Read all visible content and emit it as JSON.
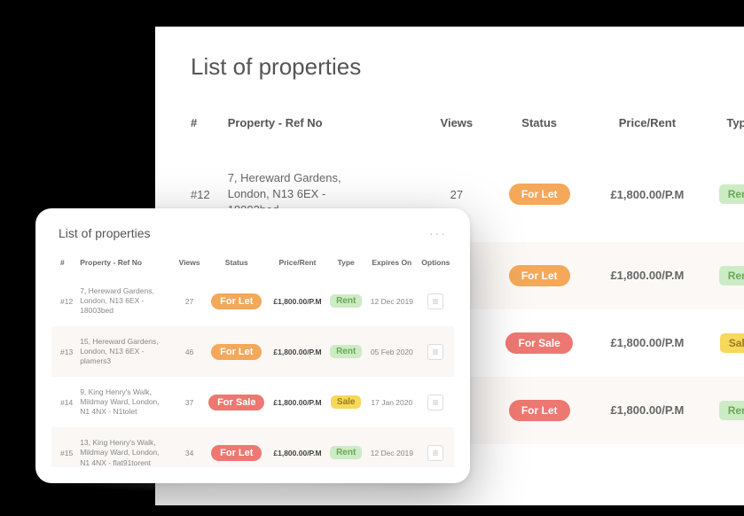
{
  "main": {
    "title": "List of properties",
    "columns": {
      "num": "#",
      "property": "Property - Ref No",
      "views": "Views",
      "status": "Status",
      "price": "Price/Rent",
      "type": "Type"
    },
    "rows": [
      {
        "num": "#12",
        "addr1": "7, Hereward Gardens,",
        "addr2": "London, N13 6EX - 18003bed",
        "views": "27",
        "status": "For Let",
        "status_kind": "orange",
        "price": "£1,800.00/P.M",
        "type": "Rent",
        "type_kind": "green",
        "alt": false
      },
      {
        "num": "",
        "addr1": "",
        "addr2": "",
        "views": "",
        "status": "For Let",
        "status_kind": "orange",
        "price": "£1,800.00/P.M",
        "type": "Rent",
        "type_kind": "green",
        "alt": true
      },
      {
        "num": "",
        "addr1": "",
        "addr2": "",
        "views": "",
        "status": "For Sale",
        "status_kind": "red",
        "price": "£1,800.00/P.M",
        "type": "Sale",
        "type_kind": "yellow",
        "alt": false
      },
      {
        "num": "",
        "addr1": "",
        "addr2": "",
        "views": "",
        "status": "For Let",
        "status_kind": "red",
        "price": "£1,800.00/P.M",
        "type": "Rent",
        "type_kind": "green",
        "alt": true
      }
    ]
  },
  "device": {
    "title": "List of properties",
    "menu_glyph": "···",
    "columns": {
      "num": "#",
      "property": "Property - Ref No",
      "views": "Views",
      "status": "Status",
      "price": "Price/Rent",
      "type": "Type",
      "expires": "Expires On",
      "options": "Options"
    },
    "rows": [
      {
        "num": "#12",
        "addr1": "7, Hereward Gardens,",
        "addr2": "London, N13 6EX - 18003bed",
        "views": "27",
        "status": "For Let",
        "status_kind": "orange",
        "price": "£1,800.00/P.M",
        "type": "Rent",
        "type_kind": "green",
        "expires": "12 Dec 2019",
        "alt": false
      },
      {
        "num": "#13",
        "addr1": "15, Hereward Gardens,",
        "addr2": "London, N13 6EX - plamers3",
        "views": "46",
        "status": "For Let",
        "status_kind": "orange",
        "price": "£1,800.00/P.M",
        "type": "Rent",
        "type_kind": "green",
        "expires": "05 Feb 2020",
        "alt": true
      },
      {
        "num": "#14",
        "addr1": "9, King Henry's Walk,",
        "addr2": "Mildmay Ward, London,",
        "addr3": "N1 4NX - N1tolet",
        "views": "37",
        "status": "For Sale",
        "status_kind": "red",
        "price": "£1,800.00/P.M",
        "type": "Sale",
        "type_kind": "yellow",
        "expires": "17 Jan 2020",
        "alt": false
      },
      {
        "num": "#15",
        "addr1": "13, King Henry's Walk,",
        "addr2": "Mildmay Ward, London,",
        "addr3": "N1 4NX - flat91torent",
        "views": "34",
        "status": "For Let",
        "status_kind": "red",
        "price": "£1,800.00/P.M",
        "type": "Rent",
        "type_kind": "green",
        "expires": "12 Dec 2019",
        "alt": true
      }
    ]
  }
}
